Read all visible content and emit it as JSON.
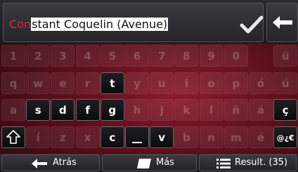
{
  "input": {
    "typed": "Con",
    "suggested": "stant Coquelin (Avenue)"
  },
  "keyboard": {
    "rows": [
      [
        "1",
        "2",
        "3",
        "4",
        "5",
        "6",
        "7",
        "8",
        "9",
        "0",
        "ü"
      ],
      [
        "q",
        "w",
        "e",
        "r",
        "t",
        "y",
        "u",
        "i",
        "o",
        "p",
        "ó",
        "ú"
      ],
      [
        "a",
        "s",
        "d",
        "f",
        "g",
        "h",
        "j",
        "k",
        "l",
        "ñ",
        "á",
        "ç"
      ],
      [
        "⇧",
        "í",
        "z",
        "x",
        "c",
        "␣",
        "v",
        "b",
        "n",
        "m",
        "é",
        "@¿€"
      ]
    ],
    "enabled": [
      "t",
      "s",
      "d",
      "f",
      "g",
      "ç",
      "c",
      "␣",
      "v",
      "@¿€",
      "⇧"
    ]
  },
  "bottom": {
    "back_label": "Atrás",
    "more_label": "Más",
    "results_label": "Result. (35)"
  }
}
